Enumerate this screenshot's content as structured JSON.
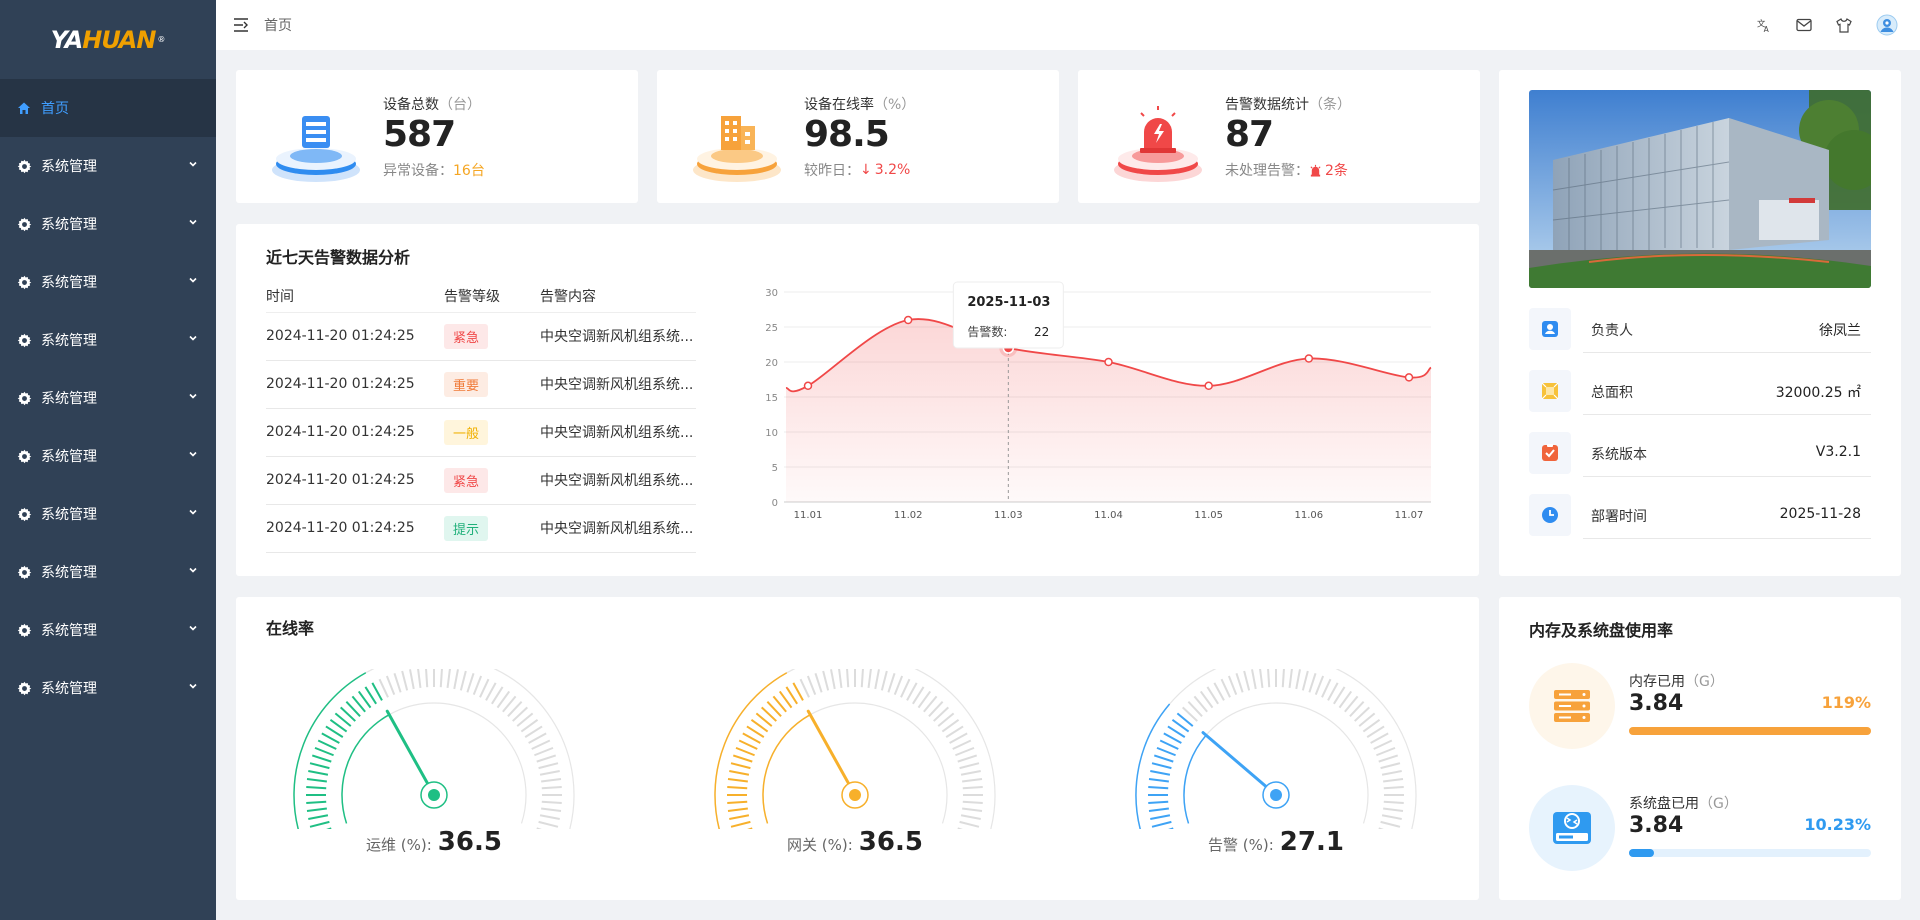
{
  "brand": {
    "logo_left": "YA",
    "logo_mid": "HUAN",
    "logo_mark": "®"
  },
  "sidebar": {
    "items": [
      {
        "label": "首页",
        "icon": "home-icon",
        "active": true
      },
      {
        "label": "系统管理",
        "icon": "gear-icon"
      },
      {
        "label": "系统管理",
        "icon": "gear-icon"
      },
      {
        "label": "系统管理",
        "icon": "gear-icon"
      },
      {
        "label": "系统管理",
        "icon": "gear-icon"
      },
      {
        "label": "系统管理",
        "icon": "gear-icon"
      },
      {
        "label": "系统管理",
        "icon": "gear-icon"
      },
      {
        "label": "系统管理",
        "icon": "gear-icon"
      },
      {
        "label": "系统管理",
        "icon": "gear-icon"
      },
      {
        "label": "系统管理",
        "icon": "gear-icon"
      },
      {
        "label": "系统管理",
        "icon": "gear-icon"
      }
    ]
  },
  "header": {
    "breadcrumb": "首页",
    "icons": [
      "translate-icon",
      "mail-icon",
      "shirt-icon",
      "user-avatar-icon"
    ]
  },
  "stats": [
    {
      "title": "设备总数",
      "unit": "（台）",
      "value": "587",
      "sub_label": "异常设备：",
      "sub_value": "16台",
      "accent": "#2f8cf0"
    },
    {
      "title": "设备在线率",
      "unit": "（%）",
      "value": "98.5",
      "sub_label": "较昨日：",
      "sub_arrow": "↓",
      "sub_value": "3.2%",
      "accent": "#f7a23b"
    },
    {
      "title": "告警数据统计",
      "unit": "（条）",
      "value": "87",
      "sub_label": "未处理告警：",
      "sub_value": "2条",
      "accent": "#f04848"
    }
  ],
  "alarm_section": {
    "title": "近七天告警数据分析",
    "columns": [
      "时间",
      "告警等级",
      "告警内容"
    ],
    "rows": [
      {
        "time": "2024-11-20 01:24:25",
        "level": "紧急",
        "level_class": "tag-urgent",
        "content": "中央空调新风机组系统..."
      },
      {
        "time": "2024-11-20 01:24:25",
        "level": "重要",
        "level_class": "tag-important",
        "content": "中央空调新风机组系统..."
      },
      {
        "time": "2024-11-20 01:24:25",
        "level": "一般",
        "level_class": "tag-normal",
        "content": "中央空调新风机组系统..."
      },
      {
        "time": "2024-11-20 01:24:25",
        "level": "紧急",
        "level_class": "tag-urgent",
        "content": "中央空调新风机组系统..."
      },
      {
        "time": "2024-11-20 01:24:25",
        "level": "提示",
        "level_class": "tag-hint",
        "content": "中央空调新风机组系统..."
      }
    ]
  },
  "chart_data": {
    "type": "area",
    "categories": [
      "11.01",
      "11.02",
      "11.03",
      "11.04",
      "11.05",
      "11.06",
      "11.07"
    ],
    "series": [
      {
        "name": "告警数",
        "values": [
          16.6,
          26,
          22,
          20,
          16.6,
          20.5,
          17.8
        ]
      }
    ],
    "ylim": [
      0,
      30
    ],
    "yticks": [
      0,
      5,
      10,
      15,
      20,
      25,
      30
    ],
    "grid": true,
    "line_color": "#f04848",
    "tooltip": {
      "title": "2025-11-03",
      "label": "告警数:",
      "value": "22",
      "index": 2
    }
  },
  "building_info": {
    "rows": [
      {
        "label": "负责人",
        "value": "徐凤兰",
        "icon": "user-card-icon",
        "color": "#2f8cf0"
      },
      {
        "label": "总面积",
        "value": "32000.25 ㎡",
        "icon": "area-icon",
        "color": "#f7c23b"
      },
      {
        "label": "系统版本",
        "value": "V3.2.1",
        "icon": "version-icon",
        "color": "#f0643b"
      },
      {
        "label": "部署时间",
        "value": "2025-11-28",
        "icon": "clock-icon",
        "color": "#2f8cf0"
      }
    ]
  },
  "online_section": {
    "title": "在线率",
    "gauges": [
      {
        "label": "运维 (%):",
        "value": "36.5",
        "percent": 36.5,
        "color": "#1fbf84"
      },
      {
        "label": "网关 (%):",
        "value": "36.5",
        "percent": 36.5,
        "color": "#f7b02b"
      },
      {
        "label": "告警 (%):",
        "value": "27.1",
        "percent": 27.1,
        "color": "#3ea3f5"
      }
    ]
  },
  "memory_section": {
    "title": "内存及系统盘使用率",
    "items": [
      {
        "title": "内存已用",
        "unit": "（G）",
        "value": "3.84",
        "percent_text": "119%",
        "fill": 1.0,
        "color": "#f7a23b",
        "track": "#fdebd3",
        "bg": "#fef6ea",
        "icon": "server-icon"
      },
      {
        "title": "系统盘已用",
        "unit": "（G）",
        "value": "3.84",
        "percent_text": "10.23%",
        "fill": 0.1023,
        "color": "#2f9af0",
        "track": "#e3f1fd",
        "bg": "#e7f3fd",
        "icon": "disk-icon"
      }
    ]
  }
}
